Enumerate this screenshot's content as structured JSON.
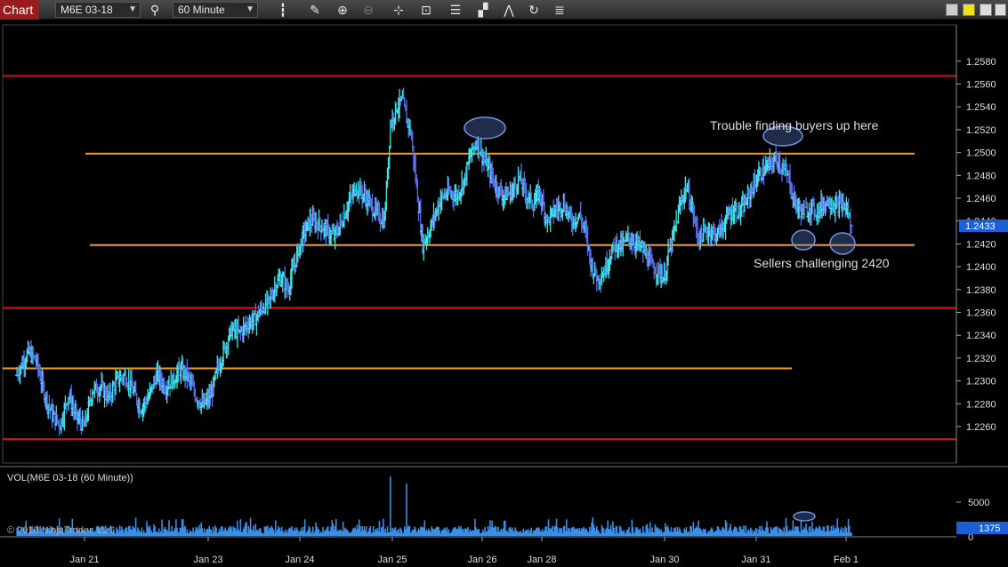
{
  "toolbar": {
    "tab_label": "Chart",
    "instrument": "M6E 03-18",
    "interval": "60 Minute",
    "icons": [
      "search-icon",
      "bar-type-icon",
      "pencil-icon",
      "zoom-in-icon",
      "zoom-out-icon",
      "crosshair-icon",
      "data-box-icon",
      "indicators-icon",
      "strategies-icon",
      "drawing-tools-icon",
      "reload-icon",
      "properties-icon"
    ]
  },
  "colors": {
    "background": "#000000",
    "bar_up": "#3ee6e6",
    "bar_down": "#5a6fe6",
    "red_line": "#d61414",
    "orange_line": "#f0a020",
    "annotation": "#5b7fd0",
    "price_marker": "#1a5fd6",
    "volume": "#3a8ee6"
  },
  "annotations": {
    "top_note": "Trouble finding buyers up here",
    "bottom_note": "Sellers challenging 2420"
  },
  "current_price": "1.2433",
  "volume_panel": {
    "label": "VOL(M6E 03-18 (60 Minute))",
    "current_value": "1375",
    "ticks": [
      "5000",
      "0"
    ]
  },
  "copyright": "© 2018 NinjaTrader, LLC",
  "chart_data": {
    "type": "ohlc",
    "title": "",
    "y_ticks": [
      "1.2580",
      "1.2560",
      "1.2540",
      "1.2520",
      "1.2500",
      "1.2480",
      "1.2460",
      "1.2440",
      "1.2420",
      "1.2400",
      "1.2380",
      "1.2360",
      "1.2340",
      "1.2320",
      "1.2300",
      "1.2280",
      "1.2260"
    ],
    "ylim": [
      1.2246,
      1.2597
    ],
    "x_ticks": [
      "Jan 21",
      "Jan 23",
      "Jan 24",
      "Jan 25",
      "Jan 26",
      "Jan 28",
      "Jan 30",
      "Jan 31",
      "Feb 1"
    ],
    "horizontal_levels": [
      {
        "price": 1.2567,
        "color": "red"
      },
      {
        "price": 1.2499,
        "color": "orange"
      },
      {
        "price": 1.2419,
        "color": "orange"
      },
      {
        "price": 1.2364,
        "color": "red"
      },
      {
        "price": 1.2311,
        "color": "orange"
      },
      {
        "price": 1.2249,
        "color": "red"
      }
    ],
    "price_path": [
      [
        0,
        1.2305
      ],
      [
        12,
        1.2325
      ],
      [
        20,
        1.2318
      ],
      [
        28,
        1.229
      ],
      [
        36,
        1.227
      ],
      [
        44,
        1.2262
      ],
      [
        52,
        1.2288
      ],
      [
        60,
        1.2268
      ],
      [
        68,
        1.226
      ],
      [
        76,
        1.2292
      ],
      [
        84,
        1.2295
      ],
      [
        92,
        1.2285
      ],
      [
        100,
        1.23
      ],
      [
        108,
        1.2305
      ],
      [
        116,
        1.2292
      ],
      [
        124,
        1.2276
      ],
      [
        132,
        1.2286
      ],
      [
        140,
        1.2306
      ],
      [
        148,
        1.2295
      ],
      [
        156,
        1.23
      ],
      [
        162,
        1.231
      ],
      [
        170,
        1.2305
      ],
      [
        178,
        1.2288
      ],
      [
        186,
        1.2278
      ],
      [
        194,
        1.2288
      ],
      [
        200,
        1.231
      ],
      [
        208,
        1.233
      ],
      [
        214,
        1.2345
      ],
      [
        222,
        1.2342
      ],
      [
        230,
        1.235
      ],
      [
        238,
        1.2355
      ],
      [
        246,
        1.2365
      ],
      [
        252,
        1.237
      ],
      [
        258,
        1.2385
      ],
      [
        264,
        1.239
      ],
      [
        270,
        1.238
      ],
      [
        276,
        1.24
      ],
      [
        284,
        1.2425
      ],
      [
        292,
        1.244
      ],
      [
        300,
        1.2438
      ],
      [
        308,
        1.2432
      ],
      [
        316,
        1.2426
      ],
      [
        324,
        1.244
      ],
      [
        330,
        1.2455
      ],
      [
        338,
        1.247
      ],
      [
        346,
        1.2462
      ],
      [
        354,
        1.2452
      ],
      [
        360,
        1.2445
      ],
      [
        366,
        1.244
      ],
      [
        372,
        1.2525
      ],
      [
        378,
        1.254
      ],
      [
        384,
        1.2545
      ],
      [
        388,
        1.253
      ],
      [
        392,
        1.252
      ],
      [
        398,
        1.247
      ],
      [
        404,
        1.242
      ],
      [
        410,
        1.243
      ],
      [
        416,
        1.2445
      ],
      [
        422,
        1.246
      ],
      [
        430,
        1.2465
      ],
      [
        438,
        1.2462
      ],
      [
        446,
        1.2478
      ],
      [
        452,
        1.25
      ],
      [
        458,
        1.251
      ],
      [
        464,
        1.2495
      ],
      [
        470,
        1.2485
      ],
      [
        476,
        1.2472
      ],
      [
        484,
        1.2462
      ],
      [
        492,
        1.2465
      ],
      [
        500,
        1.2478
      ],
      [
        506,
        1.2465
      ],
      [
        514,
        1.2455
      ],
      [
        520,
        1.2465
      ],
      [
        528,
        1.244
      ],
      [
        536,
        1.245
      ],
      [
        544,
        1.2455
      ],
      [
        552,
        1.244
      ],
      [
        560,
        1.2445
      ],
      [
        566,
        1.243
      ],
      [
        572,
        1.24
      ],
      [
        578,
        1.239
      ],
      [
        584,
        1.2395
      ],
      [
        590,
        1.241
      ],
      [
        596,
        1.242
      ],
      [
        602,
        1.2418
      ],
      [
        608,
        1.2425
      ],
      [
        614,
        1.2422
      ],
      [
        620,
        1.2418
      ],
      [
        626,
        1.241
      ],
      [
        632,
        1.24
      ],
      [
        640,
        1.2395
      ],
      [
        644,
        1.239
      ],
      [
        648,
        1.241
      ],
      [
        654,
        1.243
      ],
      [
        660,
        1.2455
      ],
      [
        666,
        1.247
      ],
      [
        672,
        1.245
      ],
      [
        678,
        1.2425
      ],
      [
        684,
        1.243
      ],
      [
        690,
        1.2432
      ],
      [
        696,
        1.2428
      ],
      [
        702,
        1.2435
      ],
      [
        708,
        1.2445
      ],
      [
        714,
        1.245
      ],
      [
        720,
        1.2448
      ],
      [
        726,
        1.2458
      ],
      [
        732,
        1.247
      ],
      [
        738,
        1.248
      ],
      [
        744,
        1.2485
      ],
      [
        750,
        1.249
      ],
      [
        756,
        1.2495
      ],
      [
        762,
        1.2485
      ],
      [
        768,
        1.2478
      ],
      [
        772,
        1.246
      ],
      [
        778,
        1.245
      ],
      [
        784,
        1.2448
      ],
      [
        790,
        1.2452
      ],
      [
        796,
        1.2448
      ],
      [
        802,
        1.2455
      ],
      [
        808,
        1.2458
      ],
      [
        814,
        1.2452
      ],
      [
        820,
        1.2455
      ],
      [
        826,
        1.245
      ],
      [
        830,
        1.2433
      ]
    ],
    "volume_ylim": [
      0,
      7000
    ],
    "volume_series": {
      "name": "VOL(M6E 03-18 (60 Minute))",
      "values_summary": "Hourly volume, mostly 200–1500 with spikes near 6000 around Jan 25"
    }
  }
}
